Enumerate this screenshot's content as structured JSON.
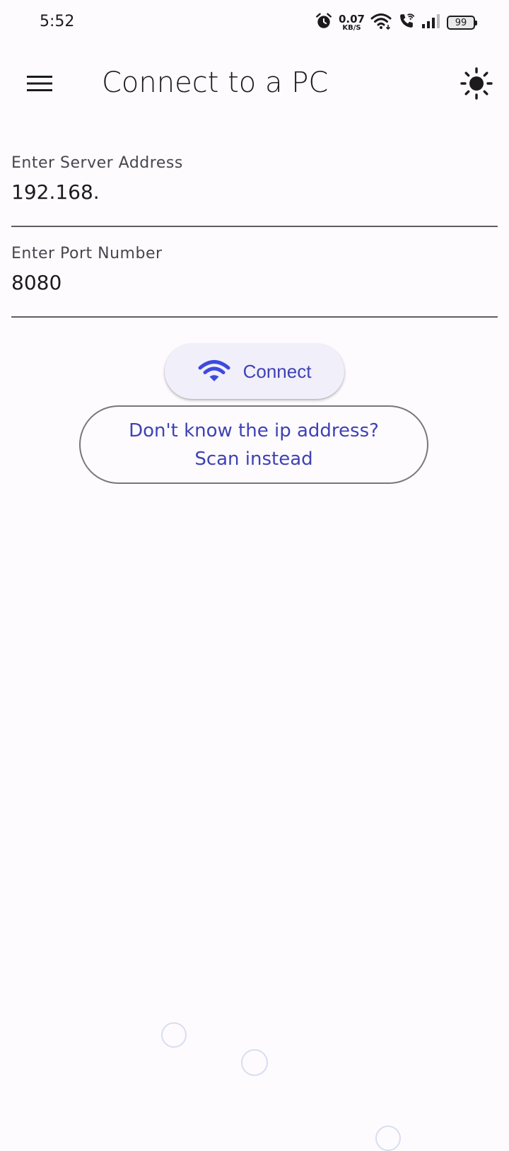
{
  "status_bar": {
    "time": "5:52",
    "net_speed_value": "0.07",
    "net_speed_unit": "KB/S",
    "battery_level": "99",
    "icons": [
      "alarm-icon",
      "wifi-icon",
      "wifi-calling-icon",
      "signal-icon",
      "battery-icon"
    ]
  },
  "app_bar": {
    "title": "Connect to a PC",
    "menu_icon": "menu-icon",
    "theme_icon": "brightness-icon"
  },
  "form": {
    "address_label": "Enter Server Address",
    "address_value": "192.168.",
    "port_label": "Enter Port Number",
    "port_value": "8080"
  },
  "actions": {
    "connect_label": "Connect",
    "connect_icon": "wifi-icon",
    "scan_line1": "Don't know the ip address?",
    "scan_line2": "Scan instead"
  },
  "colors": {
    "background": "#fefbfe",
    "accent": "#3e42b4",
    "connect_icon": "#3d4adf",
    "button_surface": "#f1effa",
    "text": "#1b1b1f"
  }
}
